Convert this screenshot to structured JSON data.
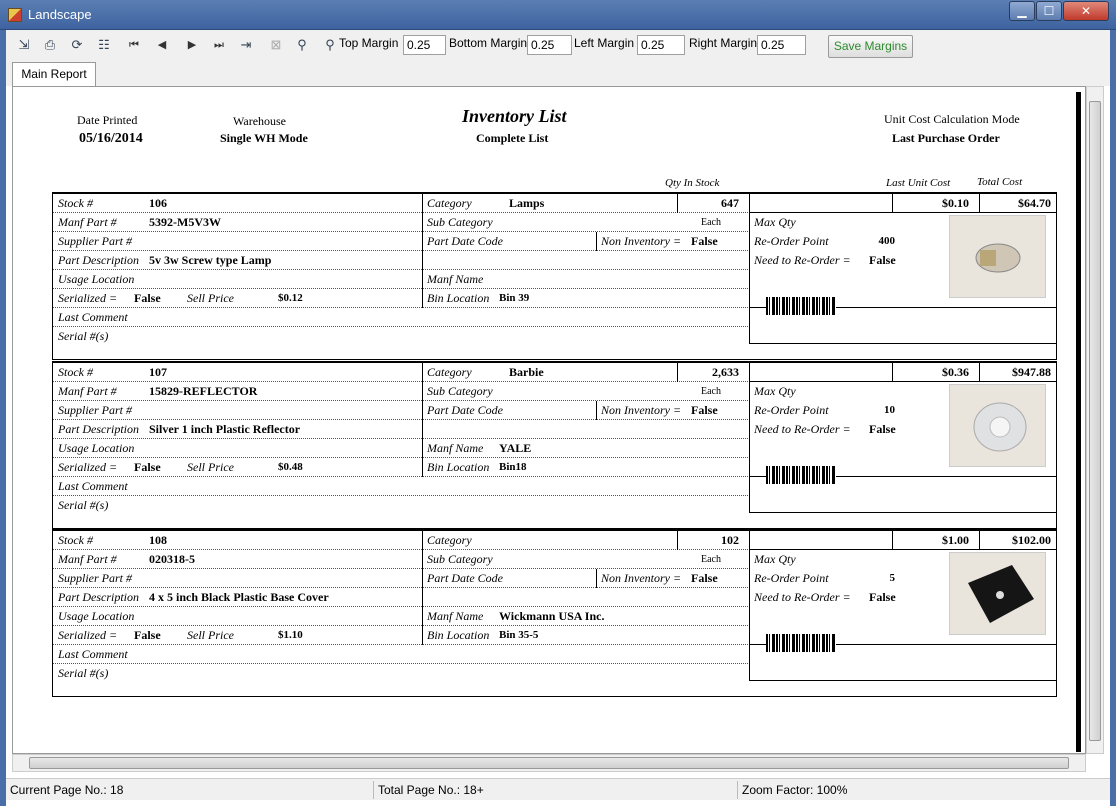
{
  "window": {
    "title": "Landscape"
  },
  "toolbar": {
    "top_margin_label": "Top Margin",
    "top_margin": "0.25",
    "bottom_margin_label": "Bottom Margin",
    "bottom_margin": "0.25",
    "left_margin_label": "Left Margin",
    "left_margin": "0.25",
    "right_margin_label": "Right Margin",
    "right_margin": "0.25",
    "save_label": "Save Margins"
  },
  "tabs": [
    {
      "label": "Main Report"
    }
  ],
  "report": {
    "date_printed_label": "Date Printed",
    "date_printed": "05/16/2014",
    "warehouse_label": "Warehouse",
    "warehouse": "Single WH Mode",
    "title": "Inventory List",
    "subtitle": "Complete List",
    "unit_cost_mode_label": "Unit Cost Calculation Mode",
    "unit_cost_mode": "Last Purchase Order",
    "col_qty": "Qty In Stock",
    "col_last_unit_cost": "Last Unit Cost",
    "col_total_cost": "Total Cost",
    "labels": {
      "stock": "Stock #",
      "manf_part": "Manf Part #",
      "supplier_part": "Supplier Part #",
      "part_description": "Part Description",
      "usage_location": "Usage Location",
      "serialized": "Serialized =",
      "sell_price": "Sell Price",
      "last_comment": "Last Comment",
      "serials": "Serial #(s)",
      "category": "Category",
      "sub_category": "Sub Category",
      "part_date_code": "Part Date Code",
      "non_inventory": "Non Inventory =",
      "manf_name": "Manf Name",
      "bin_location": "Bin Location",
      "max_qty": "Max Qty",
      "reorder_point": "Re-Order Point",
      "need_reorder": "Need to Re-Order ="
    },
    "records": [
      {
        "stock": "106",
        "manf_part": "5392-M5V3W",
        "part_description": "5v 3w Screw type Lamp",
        "serialized": "False",
        "sell_price": "$0.12",
        "category": "Lamps",
        "qty": "647",
        "uom": "Each",
        "non_inventory": "False",
        "manf_name": "",
        "bin_location": "Bin 39",
        "reorder_point": "400",
        "need_reorder": "False",
        "unit_cost": "$0.10",
        "total_cost": "$64.70"
      },
      {
        "stock": "107",
        "manf_part": "15829-REFLECTOR",
        "part_description": "Silver 1 inch Plastic Reflector",
        "serialized": "False",
        "sell_price": "$0.48",
        "category": "Barbie",
        "qty": "2,633",
        "uom": "Each",
        "non_inventory": "False",
        "manf_name": "YALE",
        "bin_location": "Bin18",
        "reorder_point": "10",
        "need_reorder": "False",
        "unit_cost": "$0.36",
        "total_cost": "$947.88"
      },
      {
        "stock": "108",
        "manf_part": "020318-5",
        "part_description": "4 x 5 inch Black Plastic Base Cover",
        "serialized": "False",
        "sell_price": "$1.10",
        "category": "",
        "qty": "102",
        "uom": "Each",
        "non_inventory": "False",
        "manf_name": "Wickmann USA Inc.",
        "bin_location": "Bin 35-5",
        "reorder_point": "5",
        "need_reorder": "False",
        "unit_cost": "$1.00",
        "total_cost": "$102.00"
      }
    ]
  },
  "status": {
    "current_page": "Current Page No.: 18",
    "total_page": "Total Page No.: 18+",
    "zoom": "Zoom Factor: 100%"
  }
}
